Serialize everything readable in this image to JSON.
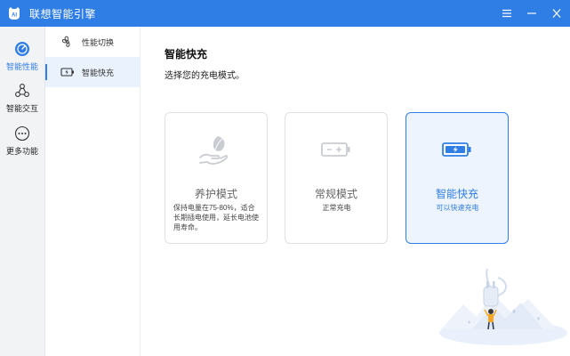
{
  "app": {
    "title": "联想智能引擎"
  },
  "left_nav": [
    {
      "label": "智能性能",
      "icon": "speedometer-icon",
      "active": true
    },
    {
      "label": "智能交互",
      "icon": "interaction-icon",
      "active": false
    },
    {
      "label": "更多功能",
      "icon": "more-icon",
      "active": false
    }
  ],
  "sub_nav": [
    {
      "label": "性能切换",
      "icon": "fan-icon",
      "active": false
    },
    {
      "label": "智能快充",
      "icon": "battery-charge-icon",
      "active": true
    }
  ],
  "main": {
    "heading": "智能快充",
    "subheading": "选择您的充电模式。",
    "cards": [
      {
        "name": "养护模式",
        "desc": "保持电量在75-80%，适合长期插电使用，延长电池使用寿命。",
        "icon": "leaf-hand-icon",
        "selected": false
      },
      {
        "name": "常规模式",
        "desc": "正常充电",
        "icon": "battery-normal-icon",
        "selected": false
      },
      {
        "name": "智能快充",
        "desc": "可以快速充电",
        "icon": "battery-fast-icon",
        "selected": true
      }
    ]
  },
  "colors": {
    "accent": "#2e7ee6",
    "selected_card_bg": "#eef4fd",
    "nav_bg": "#f2f3f5"
  }
}
